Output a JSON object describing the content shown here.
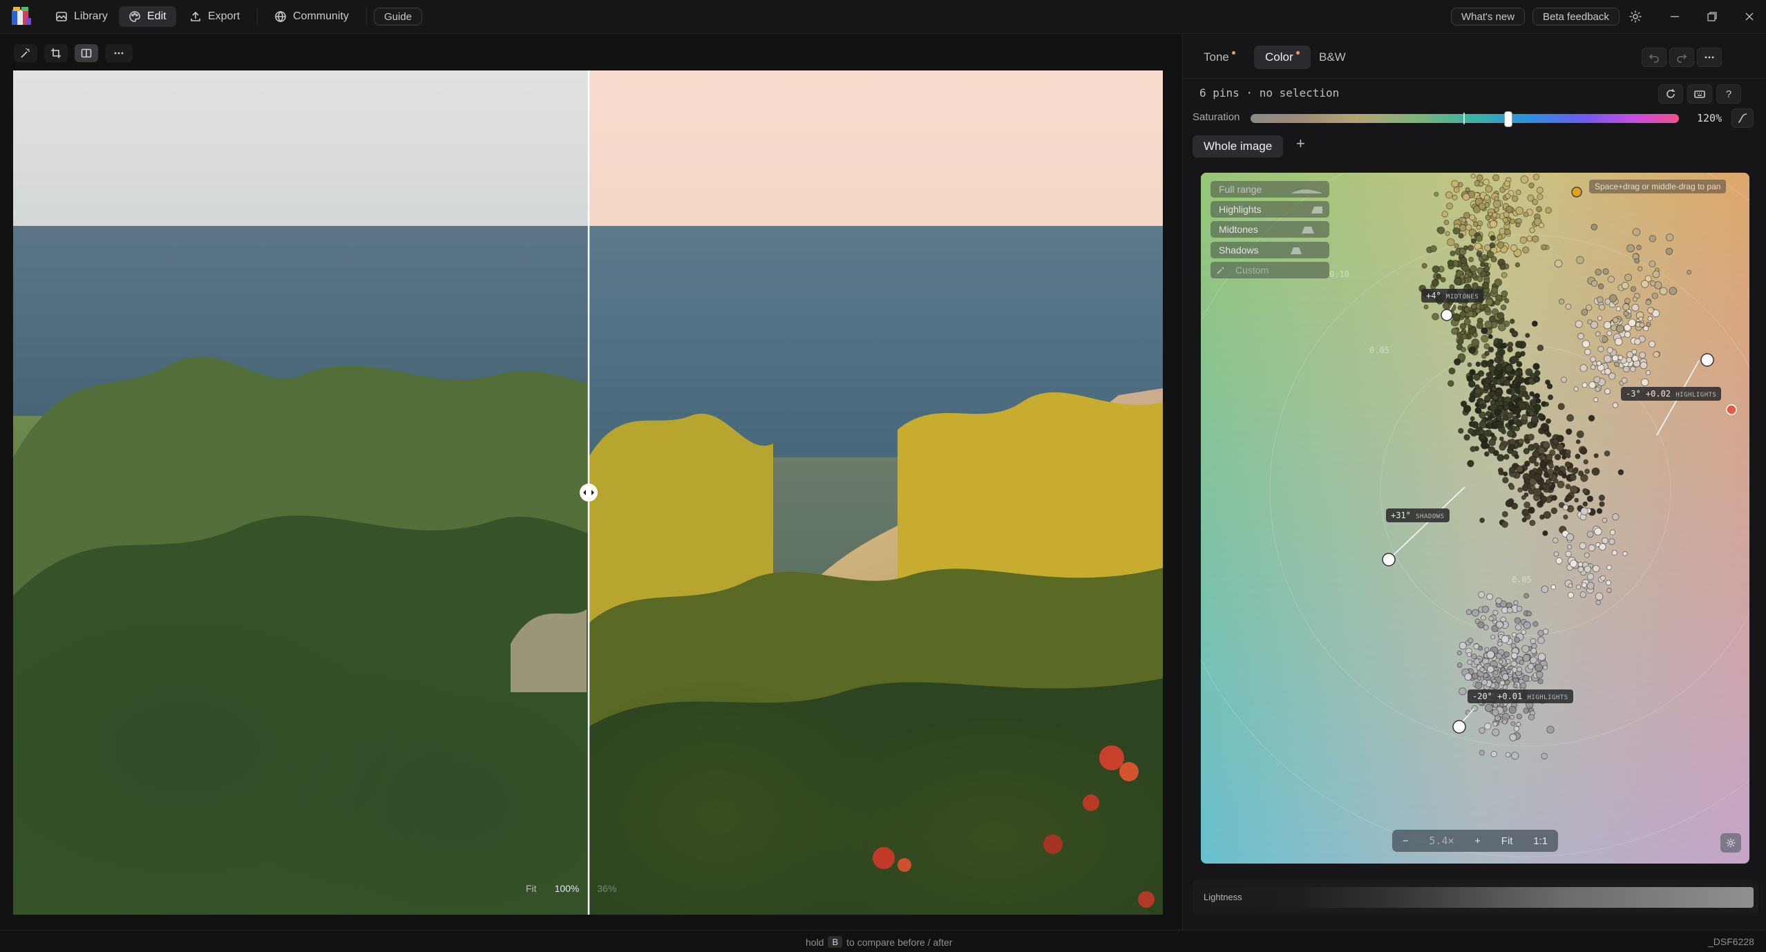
{
  "nav": {
    "library": "Library",
    "edit": "Edit",
    "export": "Export",
    "community": "Community",
    "guide": "Guide",
    "whats_new": "What's new",
    "beta_feedback": "Beta feedback"
  },
  "viewer": {
    "zoom_fit": "Fit",
    "zoom_100": "100%",
    "zoom_36": "36%"
  },
  "panel": {
    "tabs": [
      {
        "label": "Tone",
        "modified": true
      },
      {
        "label": "Color",
        "modified": true
      },
      {
        "label": "B&W",
        "modified": false
      }
    ],
    "pins_status": "6 pins · no selection",
    "saturation_label": "Saturation",
    "saturation_value": "120%",
    "scope_tab": "Whole image",
    "add_scope": "+",
    "hint": "Space+drag or middle-drag to pan",
    "ranges": [
      "Full range",
      "Highlights",
      "Midtones",
      "Shadows",
      "Custom"
    ],
    "ring_labels": [
      "0.10",
      "0.05",
      "0.05"
    ],
    "pins": [
      {
        "value": "+4°",
        "tag": "MIDTONES"
      },
      {
        "value": "-3° +0.02",
        "tag": "HIGHLIGHTS"
      },
      {
        "value": "+31°",
        "tag": "SHADOWS"
      },
      {
        "value": "-20° +0.01",
        "tag": "HIGHLIGHTS"
      }
    ],
    "zoom": {
      "minus": "−",
      "value": "5.4×",
      "plus": "+",
      "fit": "Fit",
      "one": "1:1"
    },
    "lightness_label": "Lightness"
  },
  "status": {
    "hint_pre": "hold",
    "hint_key": "B",
    "hint_post": "to compare before / after",
    "filename": "_DSF6228"
  }
}
